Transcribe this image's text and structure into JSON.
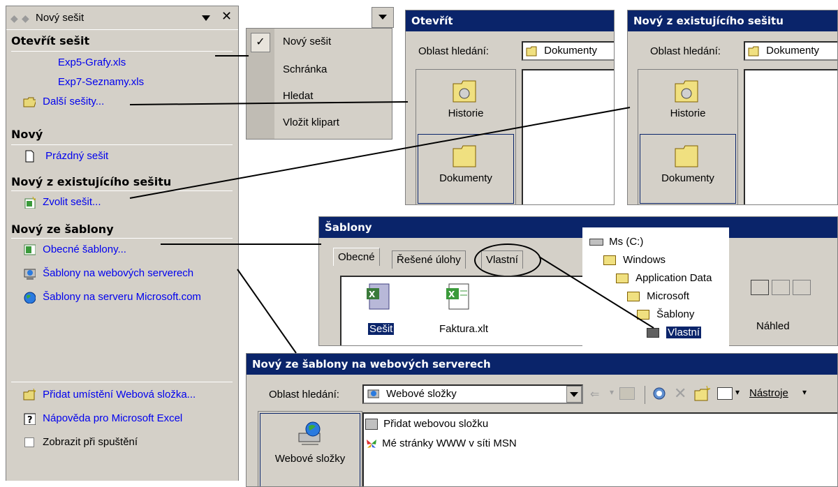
{
  "taskpane": {
    "title": "Nový sešit",
    "sections": {
      "open": {
        "header": "Otevřít sešit",
        "items": [
          "Exp5-Grafy.xls",
          "Exp7-Seznamy.xls",
          "Další sešity..."
        ]
      },
      "new": {
        "header": "Nový",
        "items": [
          "Prázdný sešit"
        ]
      },
      "existing": {
        "header": "Nový z existujícího sešitu",
        "items": [
          "Zvolit sešit..."
        ]
      },
      "template": {
        "header": "Nový ze šablony",
        "items": [
          "Obecné šablony...",
          "Šablony na webových serverech",
          "Šablony na serveru Microsoft.com"
        ]
      }
    },
    "footer": {
      "add_place": "Přidat umístění Webová složka...",
      "help": "Nápověda pro Microsoft Excel",
      "show_startup": "Zobrazit při spuštění"
    }
  },
  "dropdown_menu": {
    "items": [
      "Nový sešit",
      "Schránka",
      "Hledat",
      "Vložit klipart"
    ],
    "checked_index": 0
  },
  "open_dialog": {
    "title": "Otevřít",
    "lookin_label": "Oblast hledání:",
    "lookin_value": "Dokumenty",
    "places": [
      "Historie",
      "Dokumenty"
    ]
  },
  "existing_dialog": {
    "title": "Nový z existujícího sešitu",
    "lookin_label": "Oblast hledání:",
    "lookin_value": "Dokumenty",
    "places": [
      "Historie",
      "Dokumenty"
    ]
  },
  "templates_dialog": {
    "title": "Šablony",
    "tabs": [
      "Obecné",
      "Řešené úlohy",
      "Vlastní"
    ],
    "files": [
      "Sešit",
      "Faktura.xlt"
    ],
    "preview_label": "Náhled"
  },
  "folder_tree": {
    "items": [
      "Ms (C:)",
      "Windows",
      "Application Data",
      "Microsoft",
      "Šablony",
      "Vlastní"
    ]
  },
  "web_dialog": {
    "title": "Nový ze šablony na webových serverech",
    "lookin_label": "Oblast hledání:",
    "lookin_value": "Webové složky",
    "tools_label": "Nástroje",
    "places": [
      "Webové složky"
    ],
    "files": [
      "Přidat webovou složku",
      "Mé stránky WWW v síti MSN"
    ]
  },
  "colors": {
    "title_bar": "#0a246a",
    "face": "#d4d0c8",
    "link": "#0000ee"
  }
}
